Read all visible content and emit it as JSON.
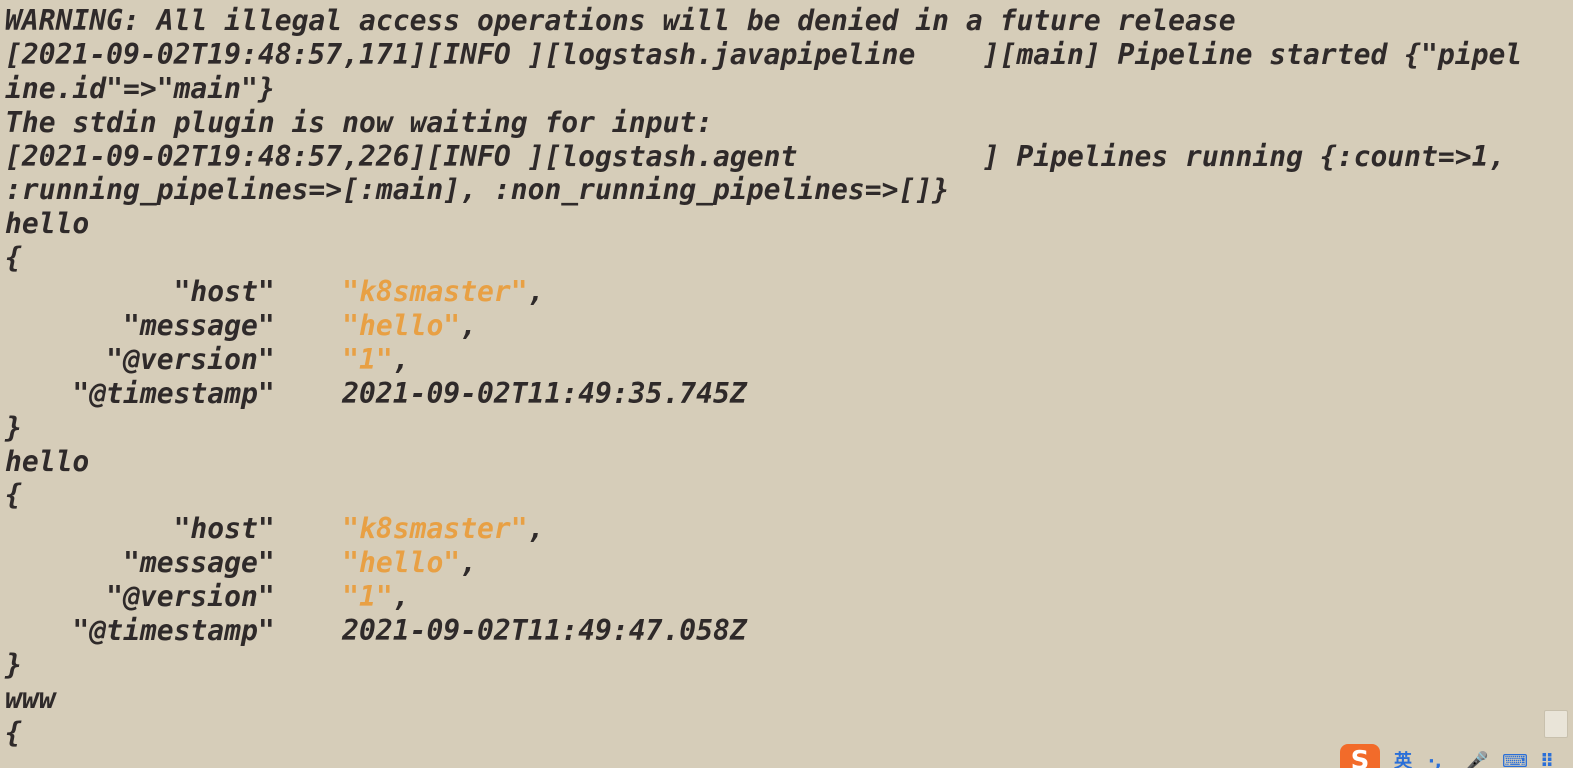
{
  "terminal": {
    "lines": [
      {
        "plain": "WARNING: All illegal access operations will be denied in a future release"
      },
      {
        "plain": "[2021-09-02T19:48:57,171][INFO ][logstash.javapipeline    ][main] Pipeline started {\"pipel"
      },
      {
        "plain": "ine.id\"=>\"main\"}"
      },
      {
        "plain": "The stdin plugin is now waiting for input:"
      },
      {
        "plain": "[2021-09-02T19:48:57,226][INFO ][logstash.agent           ] Pipelines running {:count=>1,"
      },
      {
        "plain": ":running_pipelines=>[:main], :non_running_pipelines=>[]}"
      },
      {
        "plain": "hello"
      },
      {
        "plain": "{"
      },
      {
        "key": "          \"host\"    ",
        "str": "\"k8smaster\"",
        "tail": ","
      },
      {
        "key": "       \"message\"    ",
        "str": "\"hello\"",
        "tail": ","
      },
      {
        "key": "      \"@version\"    ",
        "str": "\"1\"",
        "tail": ","
      },
      {
        "key": "    \"@timestamp\"    ",
        "str": "",
        "tail": "2021-09-02T11:49:35.745Z"
      },
      {
        "plain": "}"
      },
      {
        "plain": "hello"
      },
      {
        "plain": "{"
      },
      {
        "key": "          \"host\"    ",
        "str": "\"k8smaster\"",
        "tail": ","
      },
      {
        "key": "       \"message\"    ",
        "str": "\"hello\"",
        "tail": ","
      },
      {
        "key": "      \"@version\"    ",
        "str": "\"1\"",
        "tail": ","
      },
      {
        "key": "    \"@timestamp\"    ",
        "str": "",
        "tail": "2021-09-02T11:49:47.058Z"
      },
      {
        "plain": "}"
      },
      {
        "plain": "www"
      },
      {
        "plain": "{"
      }
    ]
  },
  "ime": {
    "logo": "S",
    "mode": "英",
    "punct": "·,",
    "mic": "🎤",
    "keyboard": "⌨",
    "grid": "⠿"
  },
  "colors": {
    "background": "#d6cdb9",
    "text": "#2f2a2a",
    "string": "#e8a044"
  }
}
